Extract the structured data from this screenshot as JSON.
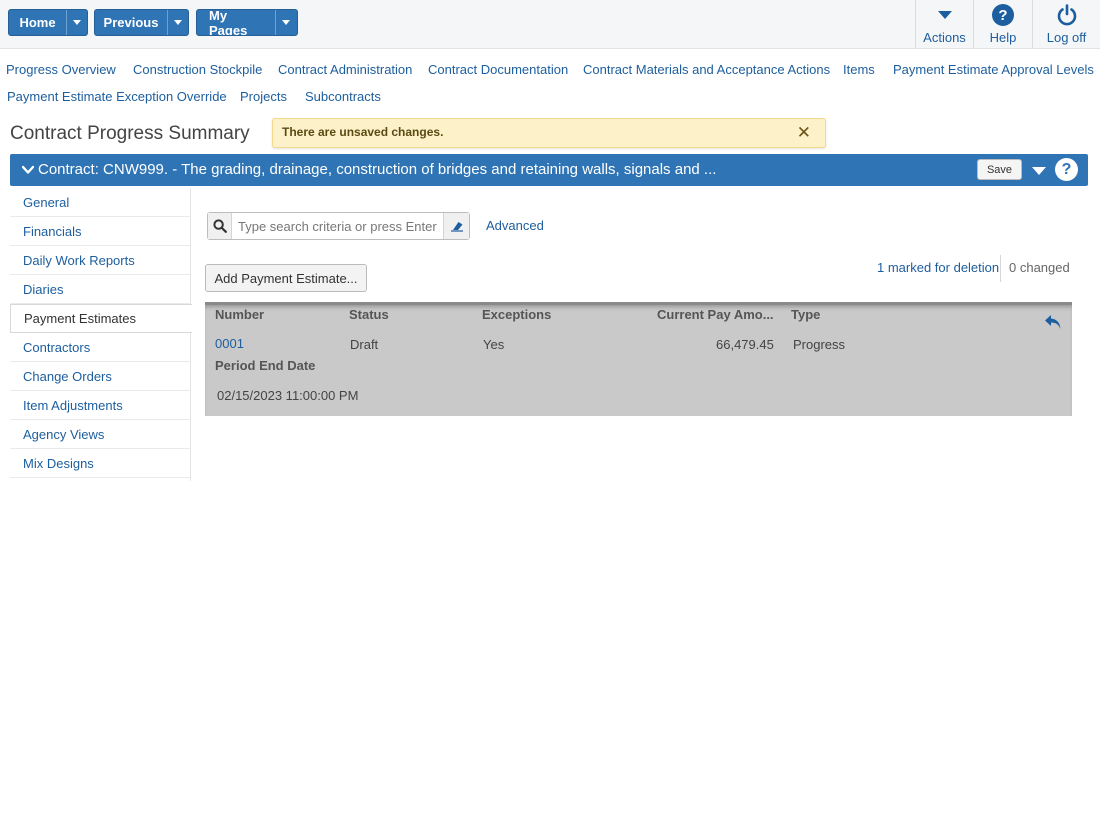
{
  "topbar": {
    "home_label": "Home",
    "previous_label": "Previous",
    "mypages_label": "My Pages",
    "actions_label": "Actions",
    "help_label": "Help",
    "logoff_label": "Log off"
  },
  "nav_links": [
    "Progress Overview",
    "Construction Stockpile",
    "Contract Administration",
    "Contract Documentation",
    "Contract Materials and Acceptance Actions",
    "Items",
    "Payment Estimate Approval Levels",
    "Payment Estimate Exception Override",
    "Projects",
    "Subcontracts"
  ],
  "page_title": "Contract Progress Summary",
  "alert": {
    "text": "There are unsaved changes.",
    "close": "✕"
  },
  "contract_bar": {
    "title": "Contract: CNW999. - The grading, drainage, construction of bridges and retaining walls, signals and ...",
    "save_label": "Save",
    "help_glyph": "?"
  },
  "sidebar": {
    "items": [
      "General",
      "Financials",
      "Daily Work Reports",
      "Diaries",
      "Payment Estimates",
      "Contractors",
      "Change Orders",
      "Item Adjustments",
      "Agency Views",
      "Mix Designs"
    ],
    "active_index": 4
  },
  "search": {
    "placeholder": "Type search criteria or press Enter",
    "value": "",
    "advanced_label": "Advanced"
  },
  "add_button_label": "Add Payment Estimate...",
  "status": {
    "marked_for_deletion": "1 marked for deletion",
    "changed": "0 changed"
  },
  "table": {
    "headers": {
      "number": "Number",
      "status": "Status",
      "exceptions": "Exceptions",
      "current_pay_amount": "Current Pay Amo...",
      "type": "Type",
      "period_end_date": "Period End Date"
    },
    "row": {
      "number": "0001",
      "status": "Draft",
      "exceptions": "Yes",
      "current_pay_amount": "66,479.45",
      "type": "Progress",
      "period_end_date": "02/15/2023 11:00:00 PM"
    }
  },
  "colors": {
    "brand_blue": "#2f74b5",
    "link_blue": "#1d5e9e",
    "alert_bg": "#fdf1c9",
    "row_bg": "#c9c9c9"
  },
  "icons": {
    "search": "search-icon",
    "clear": "eraser-icon",
    "undo": "undo-icon",
    "help": "help-icon",
    "power": "power-icon",
    "actions": "caret-down-icon"
  }
}
